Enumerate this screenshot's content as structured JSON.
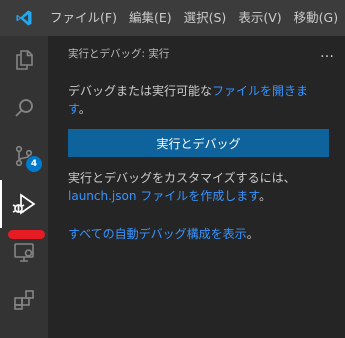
{
  "titlebar": {
    "logo_icon": "vscode-logo",
    "menu": [
      "ファイル(F)",
      "編集(E)",
      "選択(S)",
      "表示(V)",
      "移動(G)"
    ]
  },
  "activity_bar": {
    "items": [
      {
        "icon": "explorer-icon"
      },
      {
        "icon": "search-icon"
      },
      {
        "icon": "source-control-icon",
        "badge": "4"
      },
      {
        "icon": "run-and-debug-icon",
        "active": true
      },
      {
        "icon": "remote-explorer-icon"
      },
      {
        "icon": "extensions-icon"
      }
    ]
  },
  "sidebar": {
    "title": "実行とデバッグ: 実行",
    "more_icon": "…",
    "line1_text": "デバッグまたは実行可能な",
    "line1_link": "ファイルを開きます",
    "line1_end": "。",
    "run_button": "実行とデバッグ",
    "line2_text": "実行とデバッグをカスタマイズするには、",
    "line2_link": "launch.json ファイルを作成します",
    "line2_end": "。",
    "line3_link": "すべての自動デバッグ構成を表示",
    "line3_end": "。"
  },
  "colors": {
    "accent": "#007acc",
    "button": "#0e639c",
    "link": "#3794ff",
    "annotation": "#e51c24"
  }
}
